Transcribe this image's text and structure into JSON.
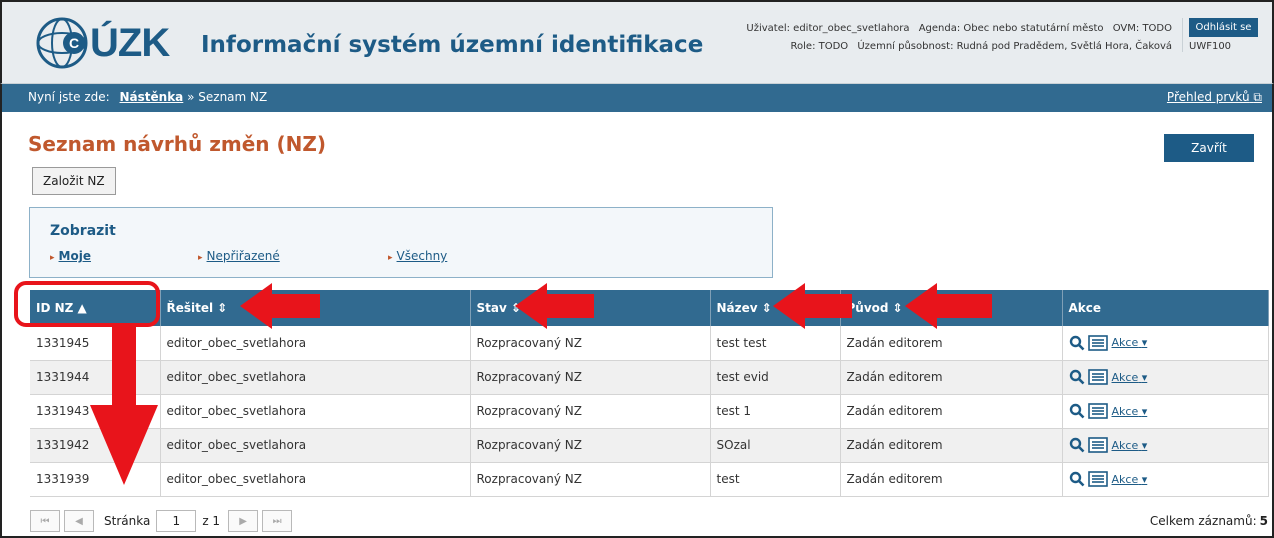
{
  "header": {
    "logo_text": "ÚZK",
    "app_title": "Informační systém územní identifikace",
    "user_label": "Uživatel: editor_obec_svetlahora",
    "agenda_label": "Agenda: Obec nebo statutární město",
    "ovm_label": "OVM: TODO",
    "role_label": "Role: TODO",
    "territory_label": "Územní působnost: Rudná pod Pradědem, Světlá Hora, Čaková",
    "logout_label": "Odhlásit se",
    "uwf_label": "UWF100"
  },
  "breadcrumb": {
    "prefix": "Nyní jste zde:",
    "home": "Nástěnka",
    "separator": "»",
    "current": "Seznam NZ",
    "overview_link": "Přehled prvků"
  },
  "page": {
    "title": "Seznam návrhů změn (NZ)",
    "close_label": "Zavřít",
    "create_label": "Založit NZ"
  },
  "filter": {
    "title": "Zobrazit",
    "options": [
      "Moje",
      "Nepřiřazené",
      "Všechny"
    ]
  },
  "table": {
    "columns": [
      "ID NZ ▲",
      "Řešitel ⇕",
      "Stav ⇕",
      "Název ⇕",
      "Původ ⇕",
      "Akce"
    ],
    "rows": [
      [
        "1331945",
        "editor_obec_svetlahora",
        "Rozpracovaný NZ",
        "test test",
        "Zadán editorem"
      ],
      [
        "1331944",
        "editor_obec_svetlahora",
        "Rozpracovaný NZ",
        "test evid",
        "Zadán editorem"
      ],
      [
        "1331943",
        "editor_obec_svetlahora",
        "Rozpracovaný NZ",
        "test 1",
        "Zadán editorem"
      ],
      [
        "1331942",
        "editor_obec_svetlahora",
        "Rozpracovaný NZ",
        "SOzal",
        "Zadán editorem"
      ],
      [
        "1331939",
        "editor_obec_svetlahora",
        "Rozpracovaný NZ",
        "test",
        "Zadán editorem"
      ]
    ],
    "action_label": "Akce"
  },
  "pager": {
    "page_label": "Stránka",
    "page_value": "1",
    "of_label": "z 1",
    "total_label": "Celkem záznamů:",
    "total_value": "5"
  },
  "colors": {
    "brand": "#1d5b86",
    "bar": "#316a90",
    "title_accent": "#c0582d",
    "annotation": "#e8141b"
  }
}
